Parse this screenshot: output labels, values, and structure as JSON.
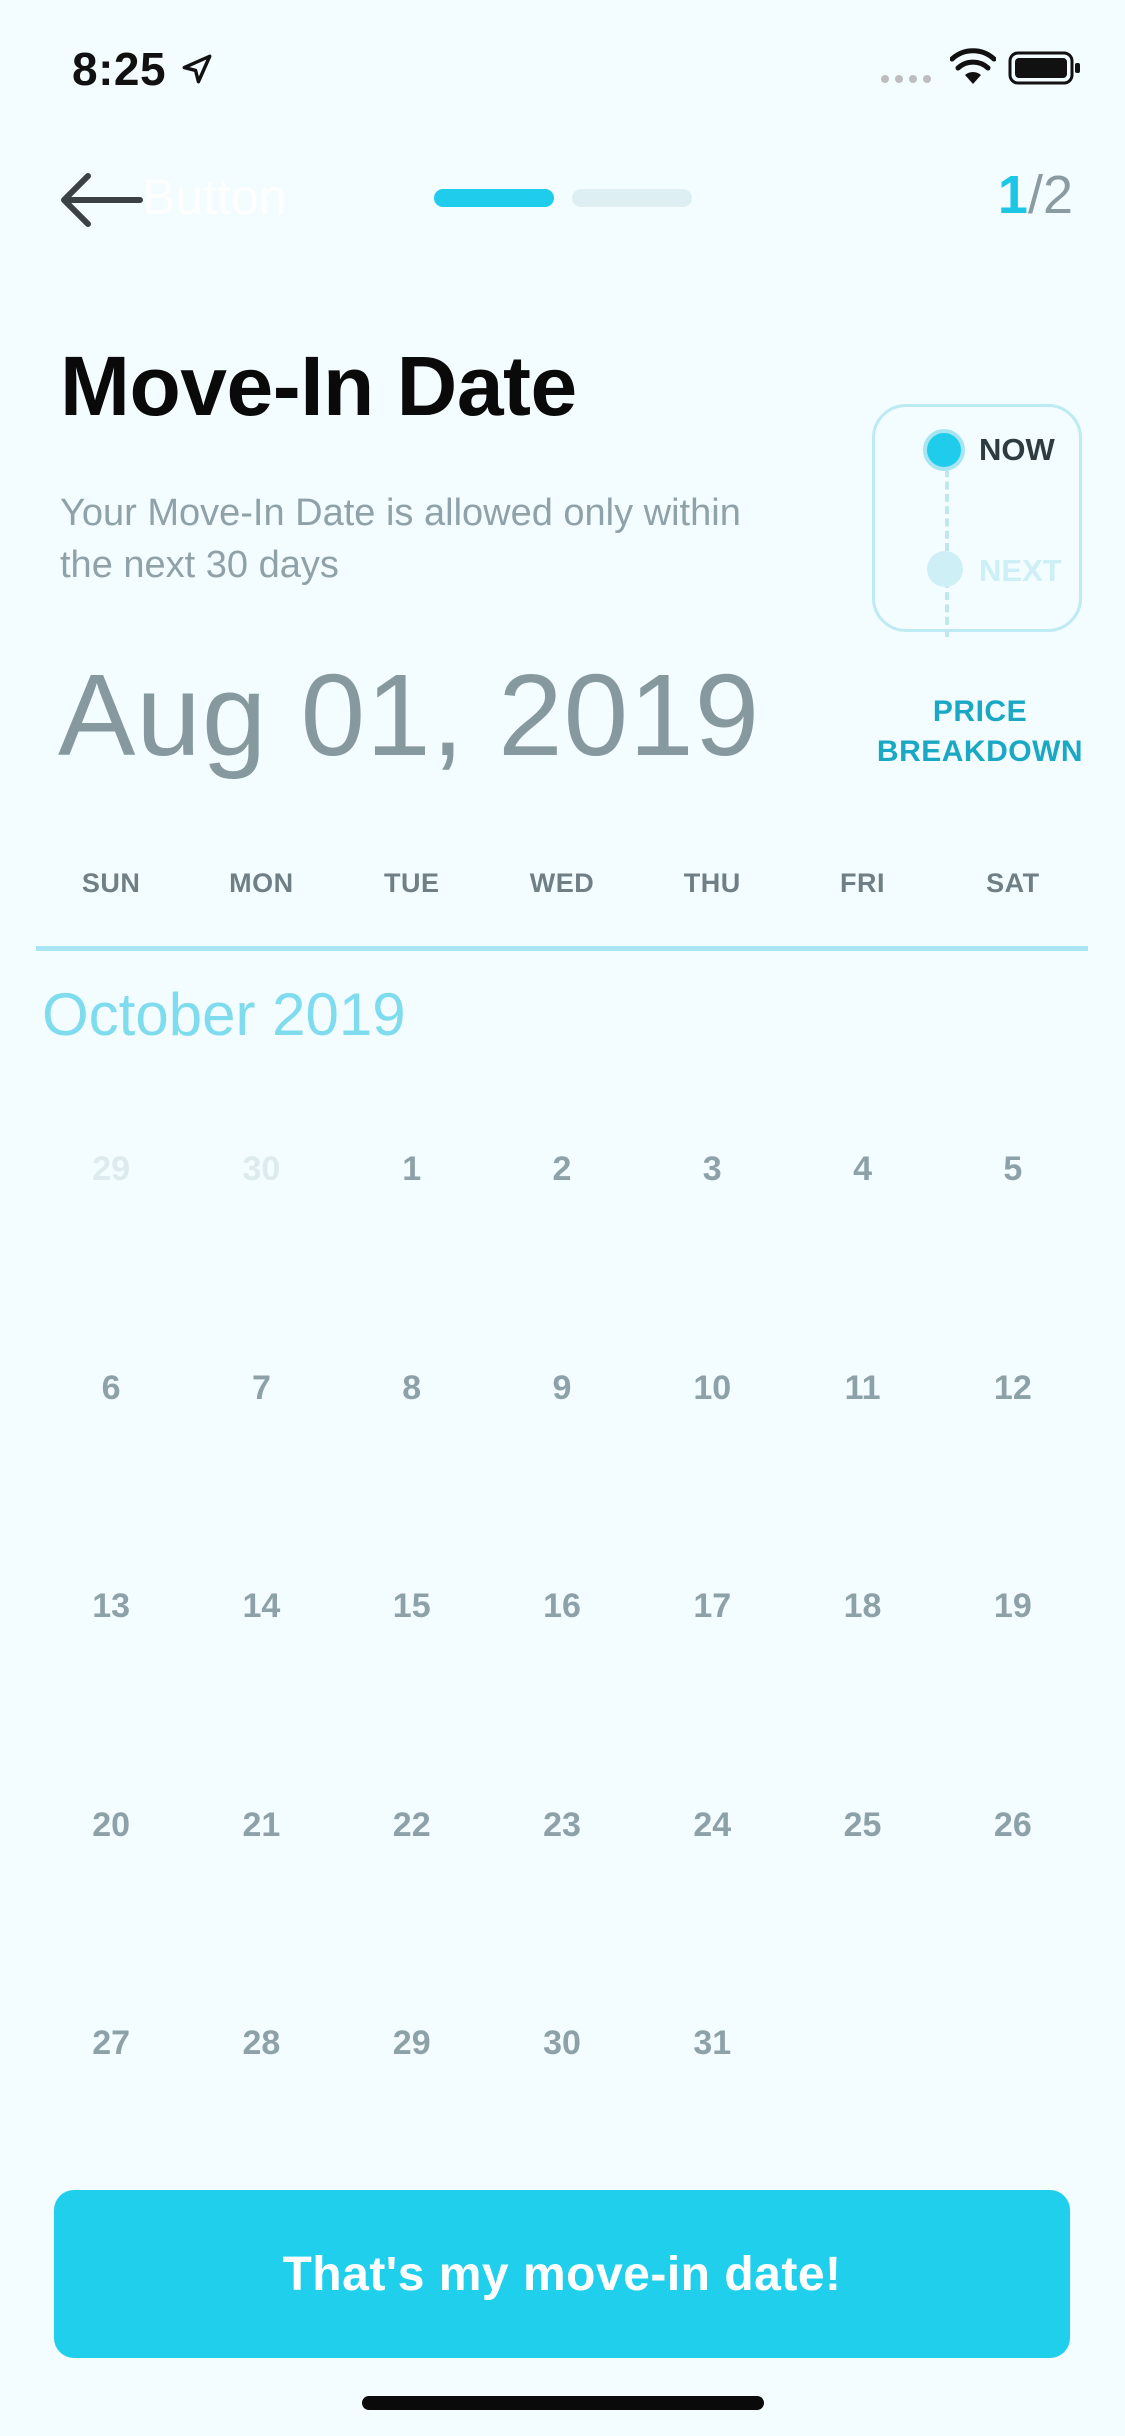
{
  "status_bar": {
    "time": "8:25",
    "icons": [
      "location-arrow-icon",
      "signal-icon",
      "wifi-icon",
      "battery-icon"
    ]
  },
  "nav": {
    "back_icon": "arrow-left-icon",
    "back_hidden_label": "Button",
    "progress_current": 1,
    "progress_total": 2,
    "step_current": "1",
    "step_total": "/2"
  },
  "header": {
    "title": "Move-In Date",
    "subtitle": "Your Move-In Date is allowed only within the next 30 days",
    "selected_date": "Aug 01, 2019"
  },
  "timeline": {
    "now_label": "NOW",
    "next_label": "NEXT"
  },
  "price_breakdown": {
    "line1": "PRICE",
    "line2": "BREAKDOWN"
  },
  "calendar": {
    "weekdays": [
      "SUN",
      "MON",
      "TUE",
      "WED",
      "THU",
      "FRI",
      "SAT"
    ],
    "month": "October 2019",
    "weeks": [
      [
        {
          "d": "29",
          "muted": true
        },
        {
          "d": "30",
          "muted": true
        },
        {
          "d": "1"
        },
        {
          "d": "2"
        },
        {
          "d": "3"
        },
        {
          "d": "4"
        },
        {
          "d": "5"
        }
      ],
      [
        {
          "d": "6"
        },
        {
          "d": "7"
        },
        {
          "d": "8"
        },
        {
          "d": "9"
        },
        {
          "d": "10"
        },
        {
          "d": "11"
        },
        {
          "d": "12"
        }
      ],
      [
        {
          "d": "13"
        },
        {
          "d": "14"
        },
        {
          "d": "15"
        },
        {
          "d": "16"
        },
        {
          "d": "17"
        },
        {
          "d": "18"
        },
        {
          "d": "19"
        }
      ],
      [
        {
          "d": "20"
        },
        {
          "d": "21"
        },
        {
          "d": "22"
        },
        {
          "d": "23"
        },
        {
          "d": "24"
        },
        {
          "d": "25"
        },
        {
          "d": "26"
        }
      ],
      [
        {
          "d": "27"
        },
        {
          "d": "28"
        },
        {
          "d": "29"
        },
        {
          "d": "30"
        },
        {
          "d": "31"
        },
        {
          "d": ""
        },
        {
          "d": ""
        }
      ]
    ]
  },
  "cta": {
    "label": "That's my move-in date!"
  },
  "colors": {
    "accent": "#20CFEC",
    "background": "#F3FCFE",
    "title": "#0A0A0A",
    "muted_text": "#8A9BA2",
    "link": "#1AA8C5"
  }
}
